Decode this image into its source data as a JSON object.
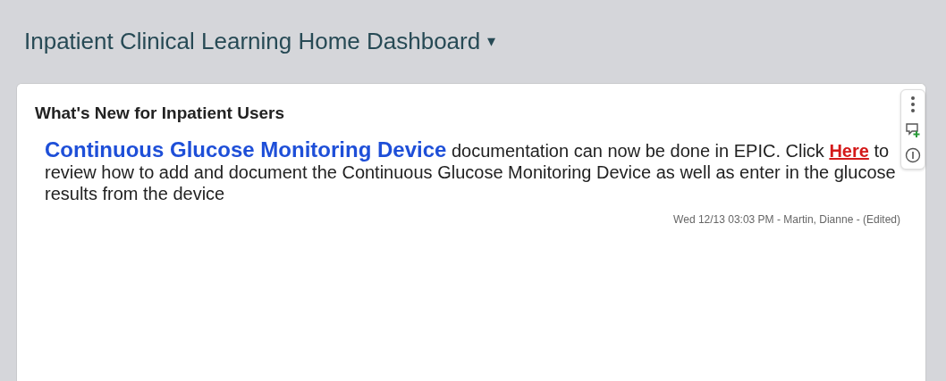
{
  "dashboard": {
    "title": "Inpatient Clinical Learning Home Dashboard",
    "caret": "▾"
  },
  "card": {
    "title": "What's New for Inpatient Users",
    "message": [
      {
        "kind": "highlight",
        "text": "Continuous Glucose Monitoring Device"
      },
      {
        "kind": "plain",
        "text": " documentation can now be done in EPIC.  Click "
      },
      {
        "kind": "link",
        "text": "Here"
      },
      {
        "kind": "plain",
        "text": " to review how to add and document the Continuous Glucose Monitoring Device as well as enter in the glucose results from the device"
      }
    ],
    "meta": "Wed 12/13 03:03 PM - Martin, Dianne - (Edited)"
  }
}
